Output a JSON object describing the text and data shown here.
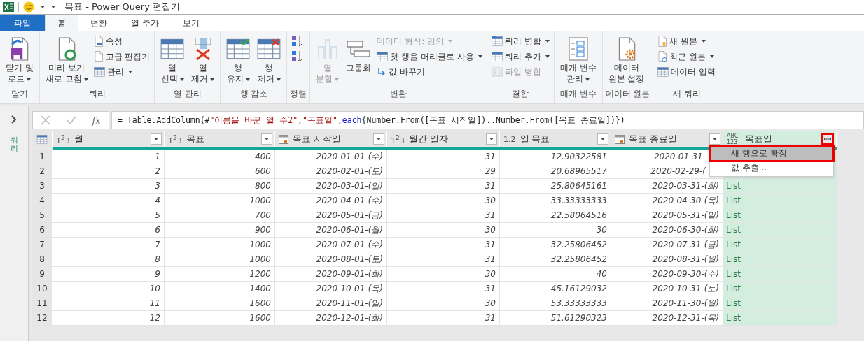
{
  "window": {
    "title": "목표 - Power Query 편집기"
  },
  "tabs": [
    {
      "label": "파일",
      "kind": "file",
      "selected": false
    },
    {
      "label": "홈",
      "kind": "tab",
      "selected": true
    },
    {
      "label": "변환",
      "kind": "tab",
      "selected": false
    },
    {
      "label": "열 추가",
      "kind": "tab",
      "selected": false
    },
    {
      "label": "보기",
      "kind": "tab",
      "selected": false
    }
  ],
  "ribbon": [
    {
      "label": "닫기",
      "items": [
        {
          "kind": "large",
          "lines": [
            "닫기 및",
            "로드"
          ],
          "dropdown": true,
          "disabled": false
        }
      ]
    },
    {
      "label": "쿼리",
      "items": [
        {
          "kind": "large",
          "lines": [
            "미리 보기",
            "새로 고침"
          ],
          "dropdown": true,
          "disabled": false
        },
        {
          "kind": "small",
          "label": "속성",
          "dropdown": false,
          "disabled": false
        },
        {
          "kind": "small",
          "label": "고급 편집기",
          "dropdown": false,
          "disabled": false
        },
        {
          "kind": "small",
          "label": "관리",
          "dropdown": true,
          "disabled": false
        }
      ]
    },
    {
      "label": "열 관리",
      "items": [
        {
          "kind": "large",
          "lines": [
            "열",
            "선택"
          ],
          "dropdown": true,
          "disabled": false
        },
        {
          "kind": "large",
          "lines": [
            "열",
            "제거"
          ],
          "dropdown": true,
          "disabled": false
        }
      ]
    },
    {
      "label": "행 감소",
      "items": [
        {
          "kind": "large",
          "lines": [
            "행",
            "유지"
          ],
          "dropdown": true,
          "disabled": false
        },
        {
          "kind": "large",
          "lines": [
            "행",
            "제거"
          ],
          "dropdown": true,
          "disabled": false
        }
      ]
    },
    {
      "label": "정렬",
      "items": [
        {
          "kind": "small",
          "dropdown": false,
          "disabled": false
        },
        {
          "kind": "small",
          "dropdown": false,
          "disabled": false
        }
      ]
    },
    {
      "label": "변환",
      "items": [
        {
          "kind": "large",
          "lines": [
            "열",
            "분할"
          ],
          "dropdown": true,
          "disabled": true
        },
        {
          "kind": "large",
          "lines": [
            "그룹화"
          ],
          "dropdown": false,
          "disabled": false
        },
        {
          "kind": "small",
          "label": "데이터 형식: 임의",
          "dropdown": true,
          "disabled": true
        },
        {
          "kind": "small",
          "label": "첫 행을 머리글로 사용",
          "dropdown": true,
          "disabled": false
        },
        {
          "kind": "small",
          "label": "값 바꾸기",
          "dropdown": false,
          "disabled": false
        }
      ]
    },
    {
      "label": "결합",
      "items": [
        {
          "kind": "small",
          "label": "쿼리 병합",
          "dropdown": true,
          "disabled": false
        },
        {
          "kind": "small",
          "label": "쿼리 추가",
          "dropdown": true,
          "disabled": false
        },
        {
          "kind": "small",
          "label": "파일 병합",
          "dropdown": false,
          "disabled": true
        }
      ]
    },
    {
      "label": "매개 변수",
      "items": [
        {
          "kind": "large",
          "lines": [
            "매개 변수",
            "관리"
          ],
          "dropdown": true,
          "disabled": false
        }
      ]
    },
    {
      "label": "데이터 원본",
      "items": [
        {
          "kind": "large",
          "lines": [
            "데이터",
            "원본 설정"
          ],
          "dropdown": false,
          "disabled": false
        }
      ]
    },
    {
      "label": "새 쿼리",
      "items": [
        {
          "kind": "small",
          "label": "새 원본",
          "dropdown": true,
          "disabled": false
        },
        {
          "kind": "small",
          "label": "최근 원본",
          "dropdown": true,
          "disabled": false
        },
        {
          "kind": "small",
          "label": "데이터 입력",
          "dropdown": false,
          "disabled": false
        }
      ]
    }
  ],
  "queries_pane": {
    "label": "쿼리",
    "expanded": false
  },
  "formula_bar": {
    "function_label": "fx",
    "formula": [
      {
        "kind": "plain",
        "text": "= Table.AddColumn(#"
      },
      {
        "kind": "string",
        "text": "\"이름을 바꾼 열 수2\""
      },
      {
        "kind": "plain",
        "text": ", "
      },
      {
        "kind": "string",
        "text": "\"목표일\""
      },
      {
        "kind": "plain",
        "text": ", "
      },
      {
        "kind": "keyword",
        "text": "each"
      },
      {
        "kind": "plain",
        "text": " {Number.From([목표 시작일])..Number.From([목표 종료일])})"
      }
    ]
  },
  "table": {
    "columns": [
      {
        "name": "월",
        "kind": "number",
        "type_label": "1$^{2}$3"
      },
      {
        "name": "목표",
        "kind": "number",
        "type_label": "1$^{2}$3"
      },
      {
        "name": "목표 시작일",
        "kind": "date"
      },
      {
        "name": "월간 일자",
        "kind": "number",
        "type_label": "1$^{2}$3"
      },
      {
        "name": "일 목표",
        "kind": "number",
        "type_label": "1.2"
      },
      {
        "name": "목표 종료일",
        "kind": "date"
      },
      {
        "name": "목표일",
        "kind": "any",
        "type_label": "ABC 123",
        "expand_button": {
          "annotated": true
        }
      }
    ],
    "rows": [
      {
        "index": "1",
        "cells": [
          "1",
          "400",
          "2020-01-01-(수)",
          "31",
          "12.90322581",
          "2020-01-31-"
        ]
      },
      {
        "index": "2",
        "cells": [
          "2",
          "600",
          "2020-02-01-(토)",
          "29",
          "20.68965517",
          "2020-02-29-("
        ]
      },
      {
        "index": "3",
        "cells": [
          "3",
          "800",
          "2020-03-01-(일)",
          "31",
          "25.80645161",
          "2020-03-31-(화)",
          "List"
        ]
      },
      {
        "index": "4",
        "cells": [
          "4",
          "1000",
          "2020-04-01-(수)",
          "30",
          "33.33333333",
          "2020-04-30-(목)",
          "List"
        ]
      },
      {
        "index": "5",
        "cells": [
          "5",
          "700",
          "2020-05-01-(금)",
          "31",
          "22.58064516",
          "2020-05-31-(일)",
          "List"
        ]
      },
      {
        "index": "6",
        "cells": [
          "6",
          "900",
          "2020-06-01-(월)",
          "30",
          "30",
          "2020-06-30-(화)",
          "List"
        ]
      },
      {
        "index": "7",
        "cells": [
          "7",
          "1000",
          "2020-07-01-(수)",
          "31",
          "32.25806452",
          "2020-07-31-(금)",
          "List"
        ]
      },
      {
        "index": "8",
        "cells": [
          "8",
          "1000",
          "2020-08-01-(토)",
          "31",
          "32.25806452",
          "2020-08-31-(월)",
          "List"
        ]
      },
      {
        "index": "9",
        "cells": [
          "9",
          "1200",
          "2020-09-01-(화)",
          "30",
          "40",
          "2020-09-30-(수)",
          "List"
        ]
      },
      {
        "index": "10",
        "cells": [
          "10",
          "1400",
          "2020-10-01-(목)",
          "31",
          "45.16129032",
          "2020-10-31-(토)",
          "List"
        ]
      },
      {
        "index": "11",
        "cells": [
          "11",
          "1600",
          "2020-11-01-(일)",
          "30",
          "53.33333333",
          "2020-11-30-(월)",
          "List"
        ]
      },
      {
        "index": "12",
        "cells": [
          "12",
          "1600",
          "2020-12-01-(화)",
          "31",
          "51.61290323",
          "2020-12-31-(목)",
          "List"
        ]
      }
    ]
  },
  "expand_menu": {
    "items": [
      {
        "label": "새 행으로 확장",
        "selected": true,
        "annotated": true
      },
      {
        "label": "값 추출...",
        "selected": false,
        "annotated": false
      }
    ]
  }
}
